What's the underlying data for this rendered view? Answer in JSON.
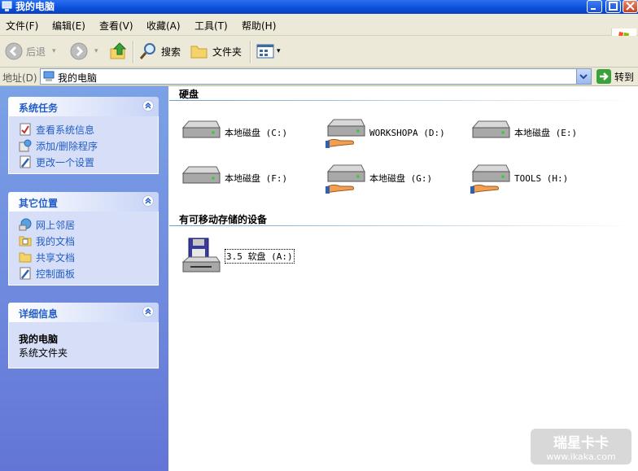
{
  "window": {
    "title": "我的电脑"
  },
  "menubar": [
    "文件(F)",
    "编辑(E)",
    "查看(V)",
    "收藏(A)",
    "工具(T)",
    "帮助(H)"
  ],
  "toolbar": {
    "back": "后退",
    "search": "搜索",
    "folders": "文件夹"
  },
  "address": {
    "label": "地址(D)",
    "value": "我的电脑",
    "go": "转到"
  },
  "sidebar": {
    "tasks": {
      "title": "系统任务",
      "items": [
        "查看系统信息",
        "添加/删除程序",
        "更改一个设置"
      ]
    },
    "places": {
      "title": "其它位置",
      "items": [
        "网上邻居",
        "我的文档",
        "共享文档",
        "控制面板"
      ]
    },
    "details": {
      "title": "详细信息",
      "name": "我的电脑",
      "type": "系统文件夹"
    }
  },
  "groups": {
    "hard_disks": {
      "title": "硬盘",
      "drives": [
        {
          "label": "本地磁盘 (C:)",
          "shared": false
        },
        {
          "label": "WORKSHOPA (D:)",
          "shared": true
        },
        {
          "label": "本地磁盘 (E:)",
          "shared": false
        },
        {
          "label": "本地磁盘 (F:)",
          "shared": false
        },
        {
          "label": "本地磁盘 (G:)",
          "shared": true
        },
        {
          "label": "TOOLS (H:)",
          "shared": true
        }
      ]
    },
    "removable": {
      "title": "有可移动存储的设备",
      "drives": [
        {
          "label": "3.5 软盘 (A:)"
        }
      ]
    }
  },
  "watermark": {
    "brand": "瑞星卡卡",
    "url": "www.ikaka.com"
  },
  "colors": {
    "title_bar": "#0a4fd6",
    "sidebar_bg": "#6f8ee0",
    "link": "#215dc6"
  }
}
